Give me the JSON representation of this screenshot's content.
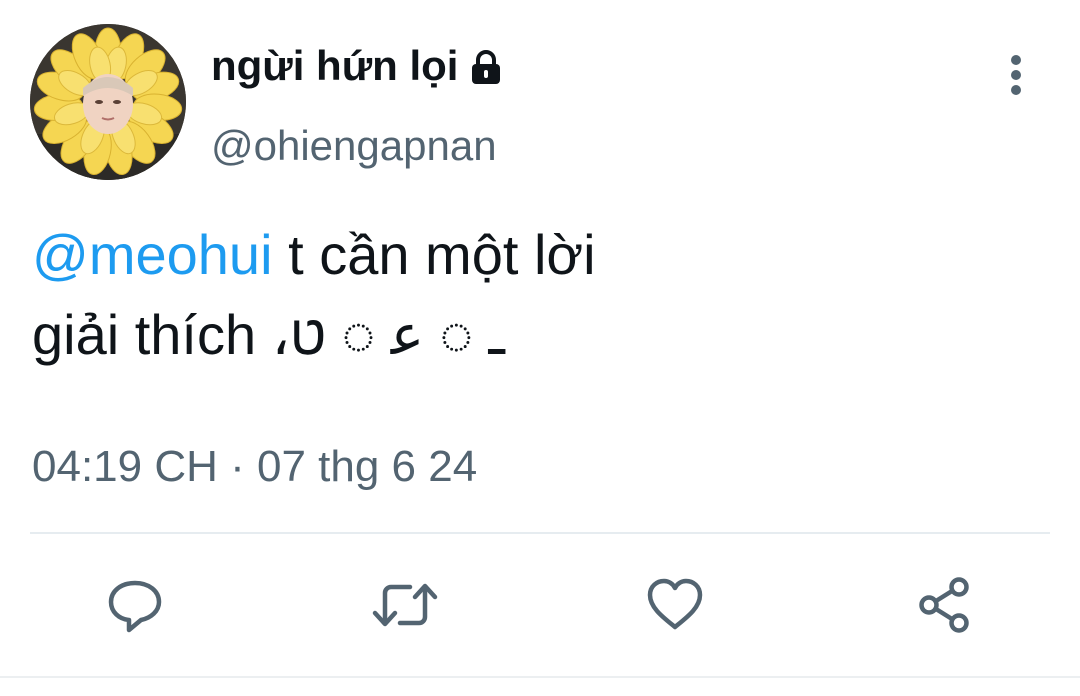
{
  "colors": {
    "text": "#0f1419",
    "secondary": "#536471",
    "mention": "#1d9bf0",
    "icon": "#536471"
  },
  "author": {
    "display_name": "ngừi hứn lọi",
    "handle": "@ohiengapnan",
    "verified_icon": "lock-icon"
  },
  "tweet": {
    "mention": "@meohui",
    "text_line1_rest": " t cần một lời",
    "text_line2": "giải thích ،ـ ◌ ﻋ ◌ ט"
  },
  "meta": {
    "timestamp": "04:19 CH · 07 thg 6 24"
  },
  "actions": [
    {
      "name": "reply",
      "icon": "reply-icon"
    },
    {
      "name": "retweet",
      "icon": "retweet-icon"
    },
    {
      "name": "like",
      "icon": "heart-icon"
    },
    {
      "name": "share",
      "icon": "share-icon"
    }
  ]
}
